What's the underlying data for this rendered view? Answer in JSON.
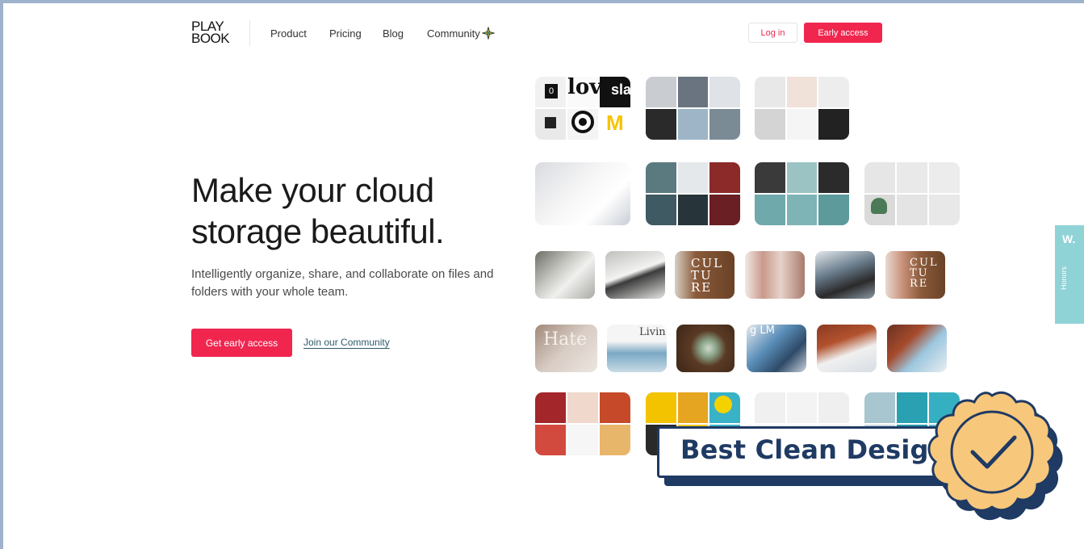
{
  "nav": {
    "logo_line1": "PLAY",
    "logo_line2": "BOOK",
    "links": [
      "Product",
      "Pricing",
      "Blog",
      "Community"
    ],
    "login_label": "Log in",
    "early_access_label": "Early access"
  },
  "hero": {
    "title_line1": "Make your cloud",
    "title_line2": "storage beautiful.",
    "subtitle": "Intelligently organize, share, and collaborate on files and folders with your whole team.",
    "cta_label": "Get early access",
    "community_link": "Join our Community"
  },
  "tiles": {
    "logo_tile_text": "lov",
    "logo_tile_text2": "sla",
    "zero": "0",
    "culture_1": "CUL TU RE",
    "culture_2": "CUL TU RE",
    "hate": "Hate",
    "living": "Livin",
    "ilm": "g LM"
  },
  "side_tab": {
    "letter": "W.",
    "label": "Honors"
  },
  "badge": {
    "label": "Best Clean Design"
  },
  "colors": {
    "accent": "#f0264f",
    "badge_navy": "#1f3a63",
    "seal_gold": "#f7c77b",
    "side_tab": "#8fd3d7"
  }
}
